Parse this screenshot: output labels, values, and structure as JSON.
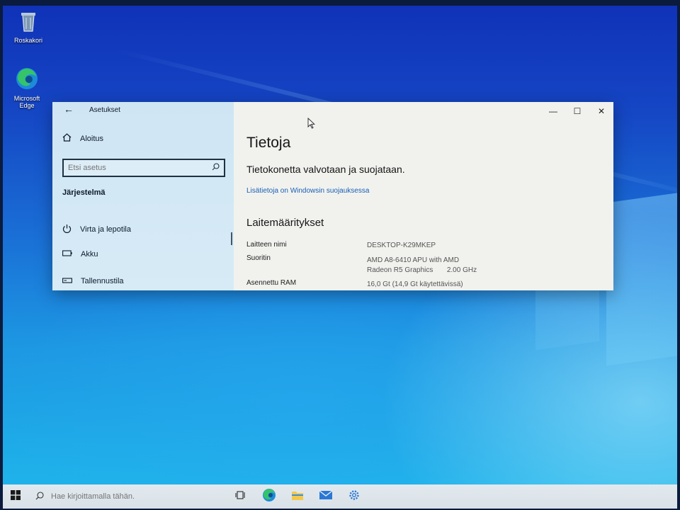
{
  "desktop": {
    "icons": [
      {
        "label": "Roskakori",
        "icon": "recycle-bin-icon"
      },
      {
        "label": "Microsoft Edge",
        "icon": "edge-icon"
      }
    ]
  },
  "window": {
    "app_title": "Asetukset",
    "controls": {
      "minimize": "—",
      "maximize": "☐",
      "close": "✕"
    },
    "sidebar": {
      "home_label": "Aloitus",
      "search_placeholder": "Etsi asetus",
      "section_title": "Järjestelmä",
      "items": [
        {
          "label": "Virta ja lepotila",
          "icon": "power-icon"
        },
        {
          "label": "Akku",
          "icon": "battery-icon"
        },
        {
          "label": "Tallennustila",
          "icon": "storage-icon"
        }
      ]
    },
    "main": {
      "page_title": "Tietoja",
      "protection_status": "Tietokonetta valvotaan ja suojataan.",
      "security_link": "Lisätietoja on Windowsin suojauksessa",
      "specs_title": "Laitemääritykset",
      "specs": [
        {
          "label": "Laitteen nimi",
          "value": "DESKTOP-K29MKEP"
        },
        {
          "label": "Suoritin",
          "value_line1": "AMD A8-6410 APU with AMD",
          "value_line2": "Radeon R5 Graphics       2.00 GHz"
        },
        {
          "label": "Asennettu RAM",
          "value": "16,0 Gt (14,9 Gt käytettävissä)"
        }
      ]
    }
  },
  "taskbar": {
    "search_placeholder": "Hae kirjoittamalla tähän.",
    "apps": [
      "task-view-icon",
      "edge-icon",
      "file-explorer-icon",
      "mail-icon",
      "settings-icon"
    ]
  },
  "colors": {
    "accent_link": "#1a5fb4",
    "sidebar_bg": "#cfe5f4",
    "taskbar_bg": "#e2e9ee"
  }
}
